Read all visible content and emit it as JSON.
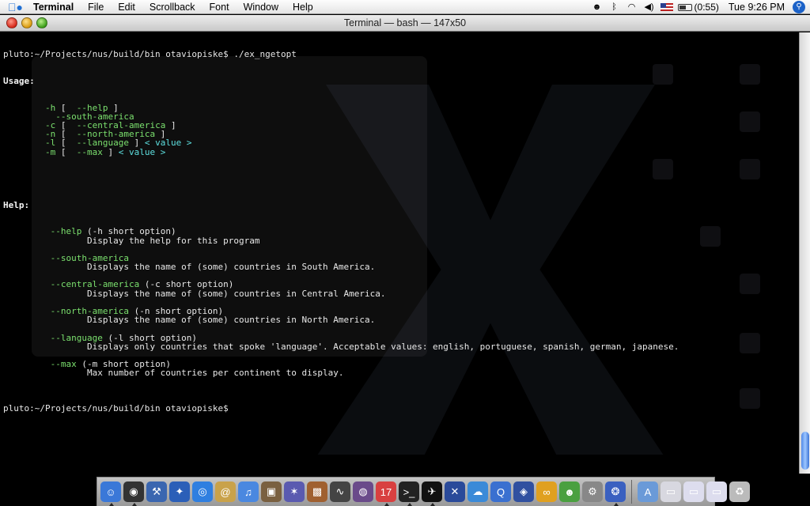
{
  "menubar": {
    "app_name": "Terminal",
    "items": [
      "File",
      "Edit",
      "Scrollback",
      "Font",
      "Window",
      "Help"
    ],
    "battery": "(0:55)",
    "clock": "Tue 9:26 PM"
  },
  "window": {
    "title": "Terminal — bash — 147x50"
  },
  "terminal": {
    "prompt_command": "pluto:~/Projects/nus/build/bin otaviopiske$ ./ex_ngetopt",
    "usage_label": "Usage:",
    "usage_lines": [
      {
        "flag": "-h",
        "open": " [  ",
        "long": "--help",
        "close": " ]",
        "arg": ""
      },
      {
        "flag": "",
        "open": "",
        "long": "--south-america",
        "close": "",
        "arg": ""
      },
      {
        "flag": "-c",
        "open": " [  ",
        "long": "--central-america",
        "close": " ]",
        "arg": ""
      },
      {
        "flag": "-n",
        "open": " [  ",
        "long": "--north-america",
        "close": " ]",
        "arg": ""
      },
      {
        "flag": "-l",
        "open": " [  ",
        "long": "--language",
        "close": " ] ",
        "arg": "< value >"
      },
      {
        "flag": "-m",
        "open": " [  ",
        "long": "--max",
        "close": " ] ",
        "arg": "< value >"
      }
    ],
    "help_label": "Help:",
    "help_entries": [
      {
        "option": "--help",
        "short": " (-h short option)",
        "desc": "Display the help for this program"
      },
      {
        "option": "--south-america",
        "short": "",
        "desc": "Displays the name of (some) countries in South America."
      },
      {
        "option": "--central-america",
        "short": " (-c short option)",
        "desc": "Displays the name of (some) countries in Central America."
      },
      {
        "option": "--north-america",
        "short": " (-n short option)",
        "desc": "Displays the name of (some) countries in North America."
      },
      {
        "option": "--language",
        "short": " (-l short option)",
        "desc": "Displays only countries that spoke 'language'. Acceptable values: english, portuguese, spanish, german, japanese."
      },
      {
        "option": "--max",
        "short": " (-m short option)",
        "desc": "Max number of countries per continent to display."
      }
    ],
    "final_prompt": "pluto:~/Projects/nus/build/bin otaviopiske$"
  },
  "dock": {
    "calendar_day": "17",
    "apps": [
      {
        "icon": "finder-icon",
        "color": "#3a78d8",
        "glyph": "☺"
      },
      {
        "icon": "dashboard-icon",
        "color": "#333333",
        "glyph": "◉"
      },
      {
        "icon": "xcode-icon",
        "color": "#3a66b0",
        "glyph": "⚒"
      },
      {
        "icon": "network-icon",
        "color": "#2b5fb8",
        "glyph": "✦"
      },
      {
        "icon": "safari-icon",
        "color": "#2f7fe0",
        "glyph": "◎"
      },
      {
        "icon": "address-book-icon",
        "color": "#c9a24a",
        "glyph": "@"
      },
      {
        "icon": "itunes-icon",
        "color": "#4a88e0",
        "glyph": "♫"
      },
      {
        "icon": "iphoto-icon",
        "color": "#7a6040",
        "glyph": "▣"
      },
      {
        "icon": "imovie-icon",
        "color": "#5a5ab0",
        "glyph": "✶"
      },
      {
        "icon": "photo-booth-icon",
        "color": "#a06030",
        "glyph": "▩"
      },
      {
        "icon": "activity-monitor-icon",
        "color": "#444444",
        "glyph": "∿"
      },
      {
        "icon": "globe-icon",
        "color": "#6a4a8a",
        "glyph": "◍"
      },
      {
        "icon": "ical-icon",
        "color": "#d84040",
        "glyph": "17"
      },
      {
        "icon": "terminal-icon",
        "color": "#222222",
        "glyph": ">_"
      },
      {
        "icon": "camino-icon",
        "color": "#111111",
        "glyph": "✈"
      },
      {
        "icon": "bird-icon",
        "color": "#2a4a9a",
        "glyph": "✕"
      },
      {
        "icon": "chat-icon",
        "color": "#3a8ad8",
        "glyph": "☁"
      },
      {
        "icon": "quicktime-icon",
        "color": "#3a70d0",
        "glyph": "Q"
      },
      {
        "icon": "mail-icon",
        "color": "#3050a0",
        "glyph": "◈"
      },
      {
        "icon": "cyberduck-icon",
        "color": "#e0a020",
        "glyph": "∞"
      },
      {
        "icon": "adium-icon",
        "color": "#4aa040",
        "glyph": "☻"
      },
      {
        "icon": "system-prefs-icon",
        "color": "#888888",
        "glyph": "⚙"
      },
      {
        "icon": "quicksilver-icon",
        "color": "#3a60c0",
        "glyph": "❂"
      }
    ],
    "right_items": [
      {
        "icon": "applications-folder-icon",
        "color": "#6a9ad8",
        "glyph": "A"
      },
      {
        "icon": "document-icon",
        "color": "#d8d8e0",
        "glyph": "▭"
      },
      {
        "icon": "minimized-window-icon",
        "color": "#dde",
        "glyph": "▭"
      },
      {
        "icon": "minimized-window-icon",
        "color": "#dde",
        "glyph": "▭"
      },
      {
        "icon": "trash-icon",
        "color": "#bbbbbb",
        "glyph": "♻"
      }
    ]
  }
}
